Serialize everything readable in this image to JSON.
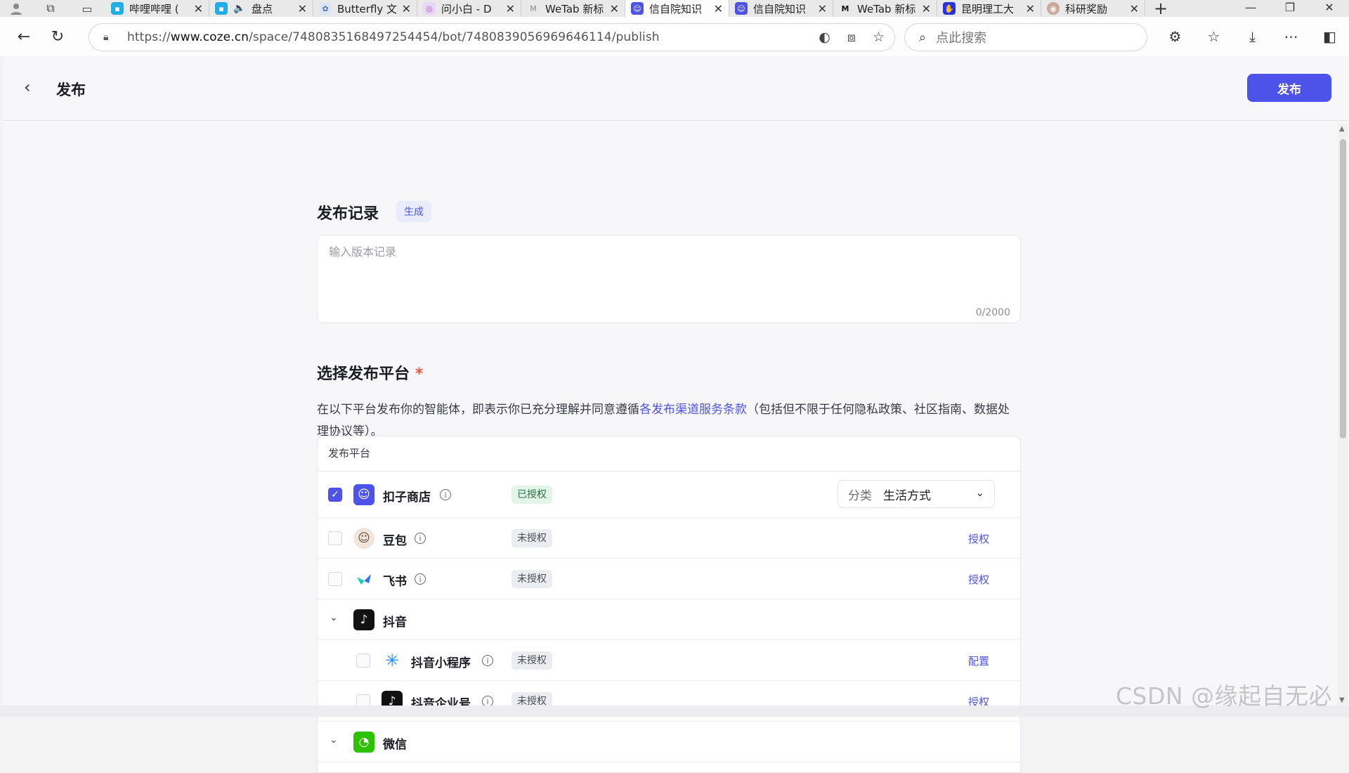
{
  "browser": {
    "tabs": [
      {
        "label": "哔哩哔哩 (",
        "icon": "bilibili-icon",
        "color": "#23ade5",
        "active": false
      },
      {
        "label": "盘点",
        "icon": "bilibili-icon",
        "color": "#23ade5",
        "active": false,
        "audio": true
      },
      {
        "label": "Butterfly 文",
        "icon": "butterfly-icon",
        "color": "#9ab6e0",
        "active": false
      },
      {
        "label": "问小白 - D",
        "icon": "wenxiaobai-icon",
        "color": "#c792ea",
        "active": false
      },
      {
        "label": "WeTab 新标",
        "icon": "wetab-icon",
        "color": "#888888",
        "active": false
      },
      {
        "label": "信自院知识",
        "icon": "coze-icon",
        "color": "#4d53e8",
        "active": true
      },
      {
        "label": "信自院知识",
        "icon": "coze-icon",
        "color": "#4d53e8",
        "active": false
      },
      {
        "label": "WeTab 新标",
        "icon": "wetab-icon",
        "color": "#222222",
        "active": false
      },
      {
        "label": "昆明理工大",
        "icon": "baidu-icon",
        "color": "#2932e1",
        "active": false
      },
      {
        "label": "科研奖励",
        "icon": "seal-icon",
        "color": "#a36a5a",
        "active": false
      }
    ],
    "url_prefix": "https://",
    "url_host": "www.coze.cn",
    "url_path": "/space/7480835168497254454/bot/7480839056969646114/publish",
    "search_placeholder": "点此搜索"
  },
  "header": {
    "title": "发布",
    "publish_button": "发布"
  },
  "record": {
    "title": "发布记录",
    "generate_badge": "生成",
    "placeholder": "输入版本记录",
    "counter": "0/2000"
  },
  "platforms": {
    "title": "选择发布平台",
    "required_mark": "*",
    "desc_before": "在以下平台发布你的智能体，即表示你已充分理解并同意遵循",
    "desc_link": "各发布渠道服务条款",
    "desc_after": "（包括但不限于任何隐私政策、社区指南、数据处理协议等）。",
    "table_header": "发布平台",
    "rows": [
      {
        "name": "扣子商店",
        "status": "已授权",
        "status_type": "ok",
        "checked": true,
        "category_label": "分类",
        "category_value": "生活方式"
      },
      {
        "name": "豆包",
        "status": "未授权",
        "status_type": "no",
        "checked": false,
        "action": "授权"
      },
      {
        "name": "飞书",
        "status": "未授权",
        "status_type": "no",
        "checked": false,
        "action": "授权"
      },
      {
        "name": "抖音",
        "group": true
      },
      {
        "name": "抖音小程序",
        "status": "未授权",
        "status_type": "no",
        "checked": false,
        "action": "配置"
      },
      {
        "name": "抖音企业号",
        "status": "未授权",
        "status_type": "no",
        "checked": false,
        "action": "授权"
      },
      {
        "name": "微信",
        "group": true
      }
    ]
  },
  "watermark": "CSDN @缘起自无必",
  "colors": {
    "accent": "#4d53e8",
    "required": "#f0554d",
    "authorized_bg": "#e3f5e8"
  }
}
